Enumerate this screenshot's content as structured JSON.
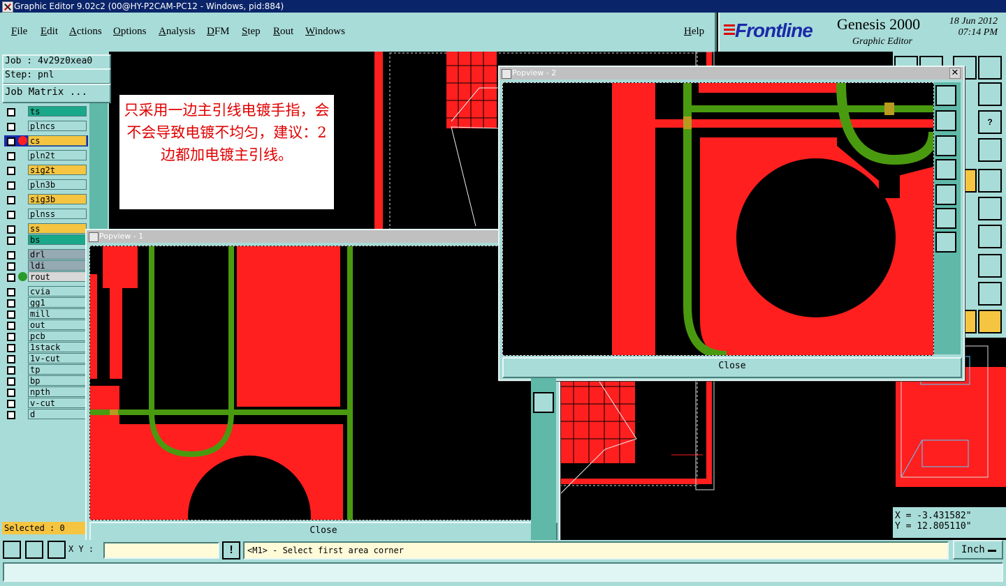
{
  "window": {
    "title": "Graphic Editor 9.02c2 (00@HY-P2CAM-PC12 - Windows, pid:884)"
  },
  "menu": {
    "items": [
      "File",
      "Edit",
      "Actions",
      "Options",
      "Analysis",
      "DFM",
      "Step",
      "Rout",
      "Windows"
    ],
    "help": "Help"
  },
  "brand": {
    "logo": "Frontline",
    "product": "Genesis 2000",
    "subtitle": "Graphic Editor",
    "date": "18 Jun 2012",
    "time": "07:14 PM"
  },
  "job": {
    "job": "Job : 4v29z0xea0",
    "step": "Step: pnl",
    "matrix_button": "Job Matrix ..."
  },
  "layers": [
    {
      "name": "ts",
      "color": "#1aa88a"
    },
    {
      "name": "plncs",
      "color": "#a8dcd8"
    },
    {
      "name": "cs",
      "color": "#f5c542",
      "active": true
    },
    {
      "name": "pln2t",
      "color": "#a8dcd8"
    },
    {
      "name": "sig2t",
      "color": "#f5c542"
    },
    {
      "name": "pln3b",
      "color": "#a8dcd8"
    },
    {
      "name": "sig3b",
      "color": "#f5c542"
    },
    {
      "name": "plnss",
      "color": "#a8dcd8"
    },
    {
      "name": "ss",
      "color": "#f5c542"
    },
    {
      "name": "bs",
      "color": "#1aa88a"
    },
    {
      "name": "drl",
      "color": "#96aab4"
    },
    {
      "name": "ldi",
      "color": "#96aab4"
    },
    {
      "name": "rout",
      "color": "#d8d8d8",
      "dot": "#2a9a2a"
    },
    {
      "name": "cvia",
      "color": "#a8dcd8"
    },
    {
      "name": "gg1",
      "color": "#a8dcd8"
    },
    {
      "name": "mill",
      "color": "#a8dcd8"
    },
    {
      "name": "out",
      "color": "#a8dcd8"
    },
    {
      "name": "pcb",
      "color": "#a8dcd8"
    },
    {
      "name": "1stack",
      "color": "#a8dcd8"
    },
    {
      "name": "1v-cut",
      "color": "#a8dcd8"
    },
    {
      "name": "tp",
      "color": "#a8dcd8"
    },
    {
      "name": "bp",
      "color": "#a8dcd8"
    },
    {
      "name": "npth",
      "color": "#a8dcd8"
    },
    {
      "name": "v-cut",
      "color": "#a8dcd8"
    },
    {
      "name": "d",
      "color": "#a8dcd8"
    }
  ],
  "selected": "Selected : 0",
  "note": "只采用一边主引线电镀手指，会不会导致电镀不均匀，建议：2边都加电镀主引线。",
  "popview1": {
    "title": "Popview - 1",
    "close": "Close"
  },
  "popview2": {
    "title": "Popview - 2",
    "close": "Close"
  },
  "status": {
    "xy_label": "X Y :",
    "xy_value": "",
    "excl": "!",
    "prompt": "<M1> - Select first area corner",
    "units": "Inch"
  },
  "coords": {
    "x": "X = -3.431582\"",
    "y": "Y = 12.805110\""
  },
  "colors": {
    "trace_red": "#ff1f1f",
    "trace_green": "#4a9a10",
    "panel": "#a8dcd8"
  }
}
